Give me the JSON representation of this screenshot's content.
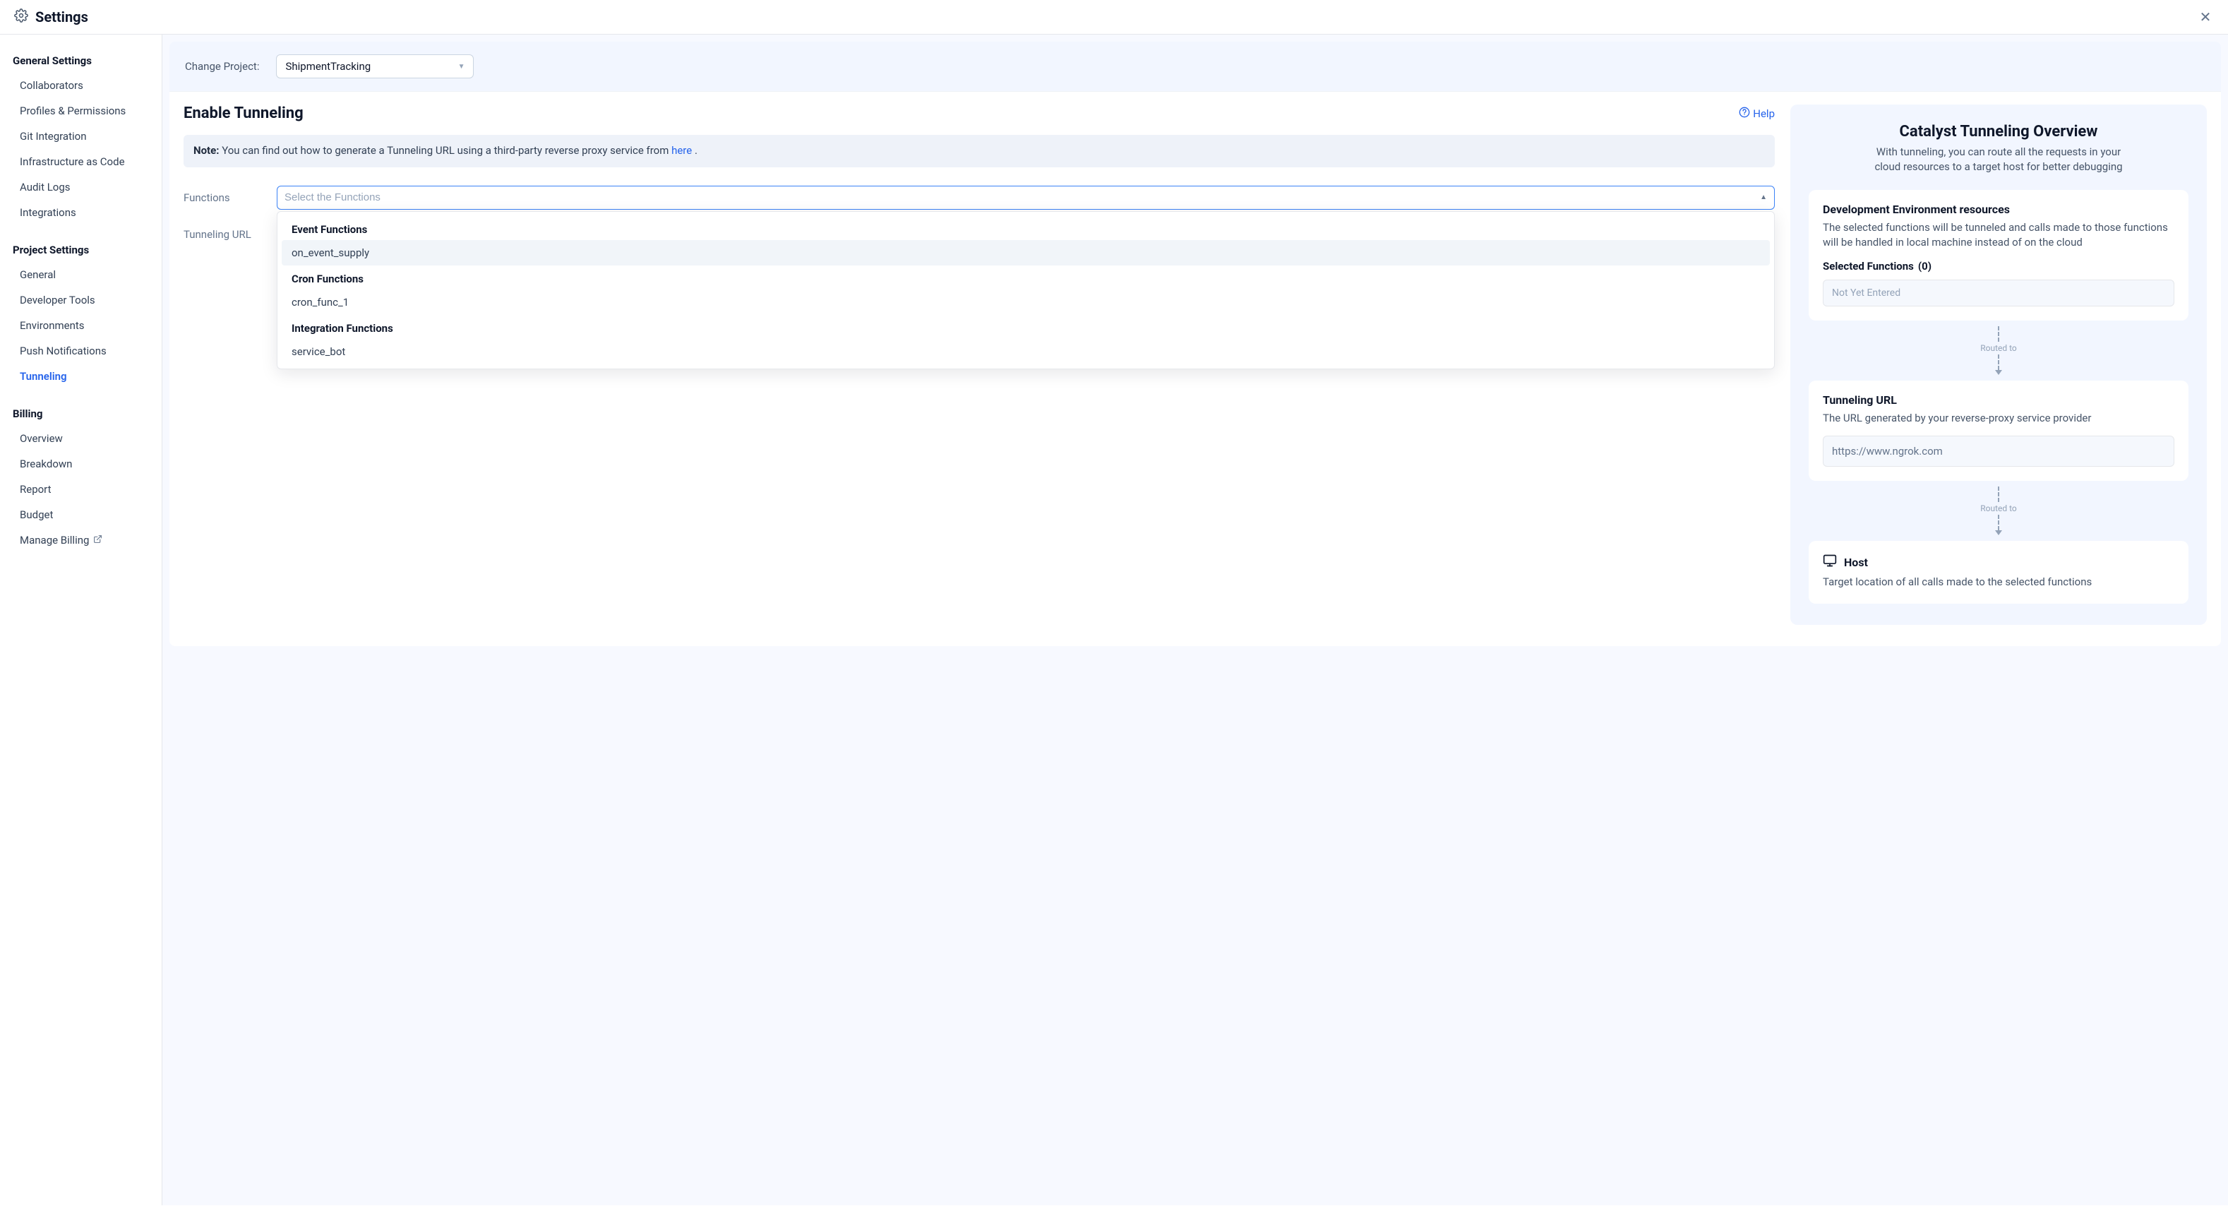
{
  "header": {
    "title": "Settings"
  },
  "sidebar": {
    "sections": [
      {
        "title": "General Settings",
        "items": [
          {
            "label": "Collaborators",
            "slug": "collaborators"
          },
          {
            "label": "Profiles & Permissions",
            "slug": "profiles-permissions"
          },
          {
            "label": "Git Integration",
            "slug": "git-integration"
          },
          {
            "label": "Infrastructure as Code",
            "slug": "infrastructure-as-code"
          },
          {
            "label": "Audit Logs",
            "slug": "audit-logs"
          },
          {
            "label": "Integrations",
            "slug": "integrations"
          }
        ]
      },
      {
        "title": "Project Settings",
        "items": [
          {
            "label": "General",
            "slug": "general"
          },
          {
            "label": "Developer Tools",
            "slug": "developer-tools"
          },
          {
            "label": "Environments",
            "slug": "environments"
          },
          {
            "label": "Push Notifications",
            "slug": "push-notifications"
          },
          {
            "label": "Tunneling",
            "slug": "tunneling",
            "active": true
          }
        ]
      },
      {
        "title": "Billing",
        "items": [
          {
            "label": "Overview",
            "slug": "overview"
          },
          {
            "label": "Breakdown",
            "slug": "breakdown"
          },
          {
            "label": "Report",
            "slug": "report"
          },
          {
            "label": "Budget",
            "slug": "budget"
          },
          {
            "label": "Manage Billing",
            "slug": "manage-billing",
            "external": true
          }
        ]
      }
    ]
  },
  "project_bar": {
    "label": "Change Project:",
    "value": "ShipmentTracking"
  },
  "main": {
    "title": "Enable Tunneling",
    "help_label": "Help",
    "note": {
      "label": "Note:",
      "text_before": "You can find out how to generate a Tunneling URL using a third-party reverse proxy service from ",
      "link_text": "here",
      "text_after": " ."
    },
    "form": {
      "functions_label": "Functions",
      "functions_placeholder": "Select the Functions",
      "tunneling_url_label": "Tunneling URL"
    },
    "dropdown": {
      "groups": [
        {
          "title": "Event Functions",
          "options": [
            {
              "label": "on_event_supply",
              "highlight": true
            }
          ]
        },
        {
          "title": "Cron Functions",
          "options": [
            {
              "label": "cron_func_1"
            }
          ]
        },
        {
          "title": "Integration Functions",
          "options": [
            {
              "label": "service_bot"
            }
          ]
        }
      ]
    }
  },
  "overview": {
    "title": "Catalyst Tunneling Overview",
    "subtitle": "With tunneling, you can route all the requests in your cloud resources to a target host for better debugging",
    "dev_env": {
      "title": "Development Environment resources",
      "desc": "The selected functions will be tunneled and calls made to those functions will be handled in local machine instead of on the cloud",
      "selected_label": "Selected Functions",
      "selected_count": "(0)",
      "empty_text": "Not Yet Entered"
    },
    "routed_label": "Routed to",
    "tunnel_url": {
      "title": "Tunneling URL",
      "desc": "The URL generated by your reverse-proxy service provider",
      "placeholder": "https://www.ngrok.com"
    },
    "host": {
      "title": "Host",
      "desc": "Target location of all calls made to the selected functions"
    }
  }
}
